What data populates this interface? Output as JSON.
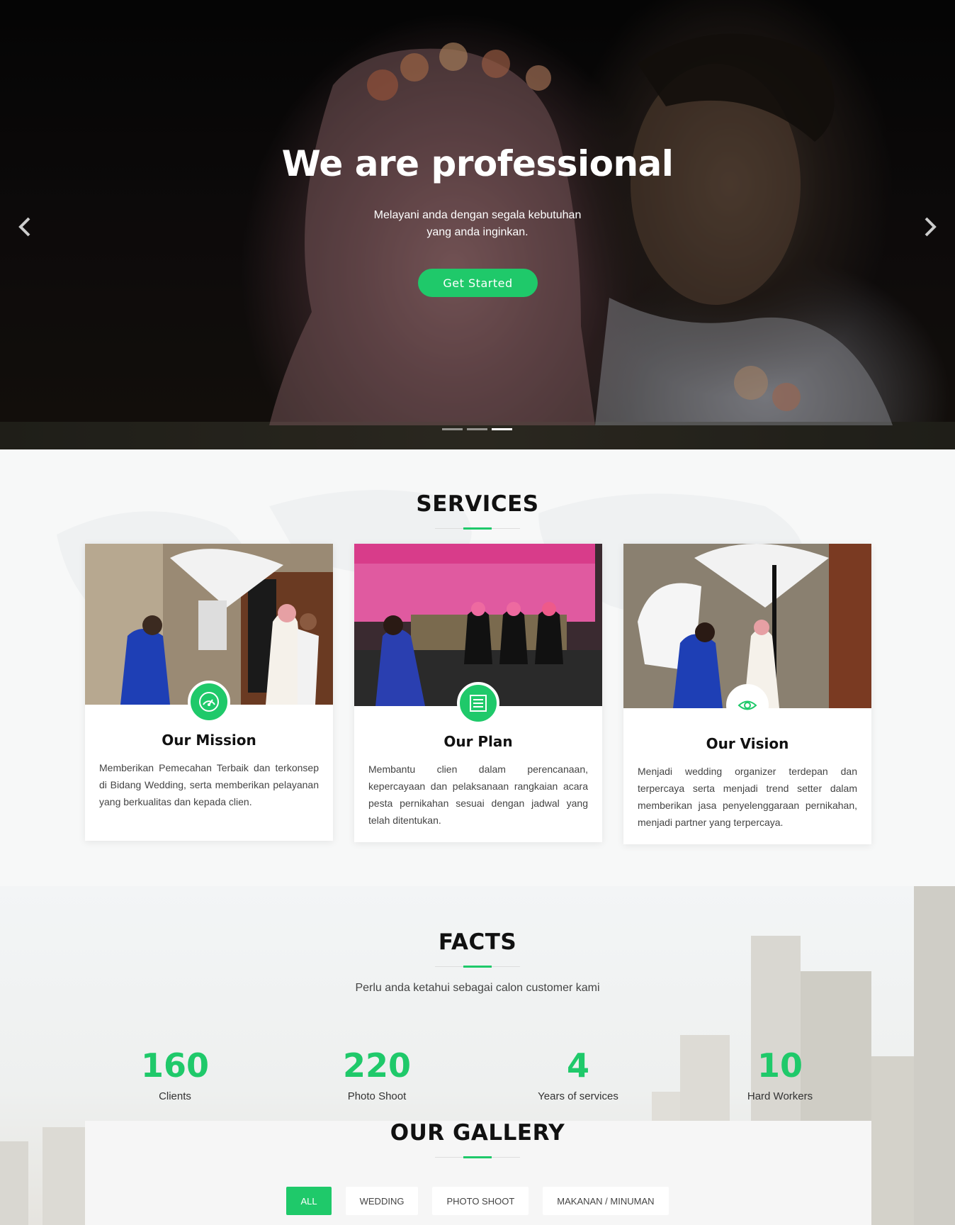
{
  "hero": {
    "title": "We are professional",
    "subtitle": "Melayani anda dengan segala kebutuhan yang anda inginkan.",
    "cta_label": "Get Started",
    "slides": 3,
    "active_slide": 3
  },
  "services": {
    "title": "SERVICES",
    "cards": [
      {
        "title": "Our Mission",
        "text": "Memberikan Pemecahan Terbaik dan terkonsep di Bidang Wedding, serta memberikan pelayanan yang berkualitas dan kepada clien.",
        "icon": "speedometer-icon"
      },
      {
        "title": "Our Plan",
        "text": "Membantu clien dalam perencanaan, kepercayaan dan pelaksanaan rangkaian acara pesta pernikahan sesuai dengan jadwal yang telah ditentukan.",
        "icon": "list-icon"
      },
      {
        "title": "Our Vision",
        "text": "Menjadi wedding organizer terdepan dan terpercaya serta menjadi trend setter dalam memberikan jasa penyelenggaraan pernikahan, menjadi partner yang terpercaya.",
        "icon": "eye-icon"
      }
    ]
  },
  "facts": {
    "title": "FACTS",
    "subtitle": "Perlu anda ketahui sebagai calon customer kami",
    "items": [
      {
        "value": "160",
        "label": "Clients"
      },
      {
        "value": "220",
        "label": "Photo Shoot"
      },
      {
        "value": "4",
        "label": "Years of services"
      },
      {
        "value": "10",
        "label": "Hard Workers"
      }
    ]
  },
  "gallery": {
    "title": "OUR GALLERY",
    "filters": [
      "ALL",
      "WEDDING",
      "PHOTO SHOOT",
      "MAKANAN / MINUMAN"
    ],
    "active_filter": "ALL"
  },
  "colors": {
    "accent": "#1fc96a",
    "text": "#111111"
  }
}
